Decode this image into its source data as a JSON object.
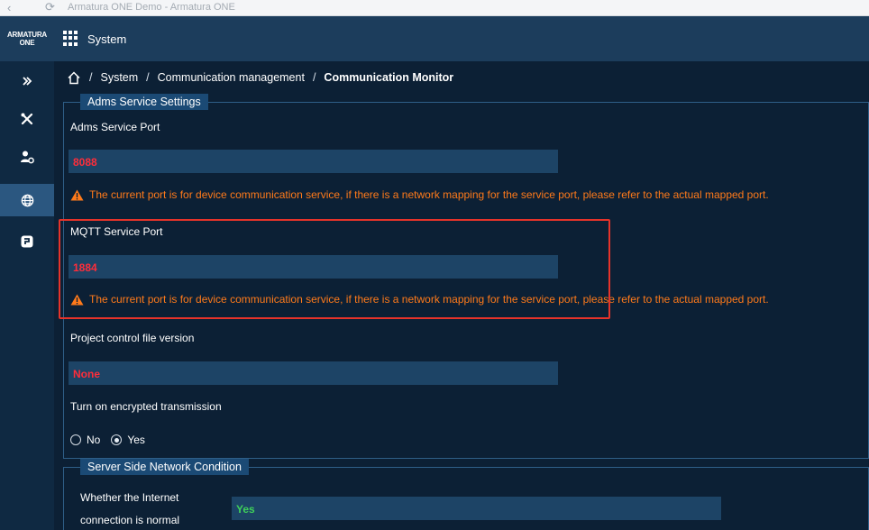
{
  "browser": {
    "tab_title": "Armatura ONE Demo - Armatura ONE"
  },
  "header": {
    "logo_line1": "ARMATURA",
    "logo_line2": "ONE",
    "app_title": "System"
  },
  "rail": {
    "items": [
      "expand-icon",
      "tools-icon",
      "user-settings-icon",
      "globe-icon",
      "communication-icon"
    ],
    "active_index": 3
  },
  "breadcrumb": {
    "items": [
      "System",
      "Communication management",
      "Communication Monitor"
    ],
    "separator": "/"
  },
  "adms_panel": {
    "legend": "Adms Service Settings",
    "adms_port_label": "Adms Service Port",
    "adms_port_value": "8088",
    "adms_warning": "The current port is for device communication service, if there is a network mapping for the service port, please refer to the actual mapped port.",
    "mqtt_port_label": "MQTT Service Port",
    "mqtt_port_value": "1884",
    "mqtt_warning": "The current port is for device communication service, if there is a network mapping for the service port, please refer to the actual mapped port.",
    "project_file_label": "Project control file version",
    "project_file_value": "None",
    "encryption_label": "Turn on encrypted transmission",
    "encryption_options": [
      "No",
      "Yes"
    ],
    "encryption_selected": "Yes"
  },
  "network_panel": {
    "legend": "Server Side Network Condition",
    "internet_label_line1": "Whether the Internet",
    "internet_label_line2": "connection is normal",
    "internet_value": "Yes"
  },
  "colors": {
    "value_red": "#ff2d3a",
    "value_green": "#3fd05a",
    "warning_orange": "#ff7a1a",
    "highlight_red": "#e6332a",
    "background": "#0c2035"
  }
}
